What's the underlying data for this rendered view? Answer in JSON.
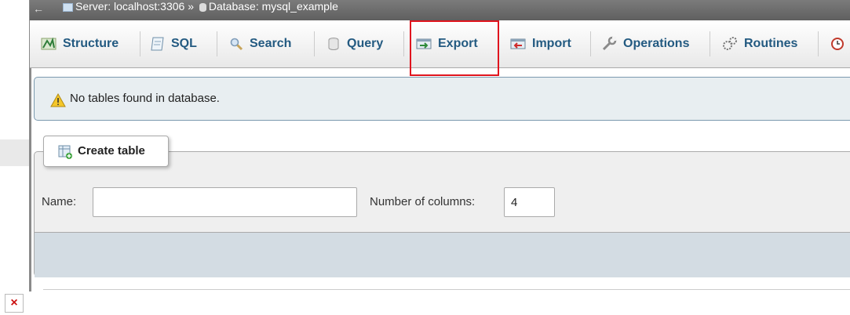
{
  "breadcrumb": {
    "nav_arrow": "←",
    "server": "Server: localhost:3306",
    "separator": "»",
    "database": "Database: mysql_example"
  },
  "tabs": [
    {
      "label": "Structure",
      "icon": "structure-icon"
    },
    {
      "label": "SQL",
      "icon": "sql-icon"
    },
    {
      "label": "Search",
      "icon": "search-icon"
    },
    {
      "label": "Query",
      "icon": "query-icon"
    },
    {
      "label": "Export",
      "icon": "export-icon",
      "highlighted": true
    },
    {
      "label": "Import",
      "icon": "import-icon"
    },
    {
      "label": "Operations",
      "icon": "wrench-icon"
    },
    {
      "label": "Routines",
      "icon": "routines-icon"
    }
  ],
  "notice": {
    "message": "No tables found in database.",
    "icon": "warning-icon"
  },
  "create_table": {
    "legend": "Create table",
    "name_label": "Name:",
    "name_value": "",
    "columns_label": "Number of columns:",
    "columns_value": "4"
  },
  "close_button": "×",
  "colors": {
    "tab_text": "#235a81",
    "highlight_border": "#e0141e",
    "notice_bg": "#e8eef1",
    "topbar_bg": "#6b6b6b"
  }
}
